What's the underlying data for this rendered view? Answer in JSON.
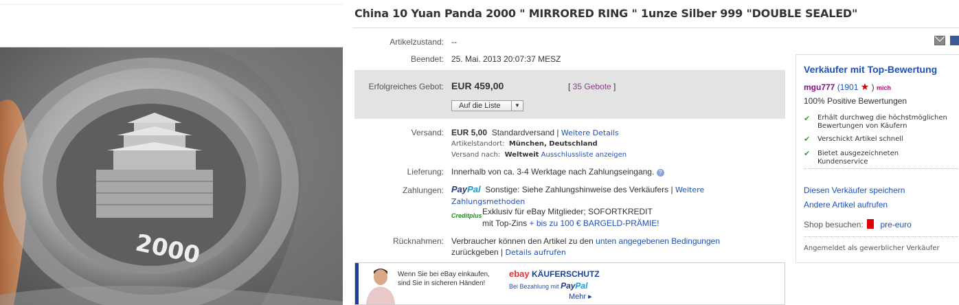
{
  "title": "China 10 Yuan Panda 2000 \" MIRRORED RING \" 1unze Silber 999 \"DOUBLE SEALED\"",
  "condition": {
    "label": "Artikelzustand:",
    "value": "--"
  },
  "ended": {
    "label": "Beendet:",
    "value": "25. Mai. 2013  20:07:37 MESZ"
  },
  "bid": {
    "label": "Erfolgreiches Gebot:",
    "price": "EUR 459,00",
    "bids_prefix": "[ ",
    "bids_link": "35 Gebote",
    "bids_suffix": " ]",
    "watch_button": "Auf die Liste"
  },
  "shipping": {
    "label": "Versand:",
    "price": "EUR 5,00",
    "method": "Standardversand |",
    "details_link": "Weitere Details",
    "location_label": "Artikelstandort:",
    "location": "München, Deutschland",
    "to_label": "Versand nach:",
    "to": "Weltweit",
    "exclusion_link": "Ausschlussliste anzeigen"
  },
  "delivery": {
    "label": "Lieferung:",
    "value": "Innerhalb von ca. 3-4 Werktage nach Zahlungseingang.",
    "help_icon": "?"
  },
  "payments": {
    "label": "Zahlungen:",
    "paypal_a": "Pay",
    "paypal_b": "Pal",
    "other": "Sonstige: Siehe Zahlungshinweise des Verkäufers  |",
    "more_link_a": "Weitere",
    "more_link_b": "Zahlungsmethoden",
    "credit_logo": "Creditplus",
    "credit_line1": "Exklusiv für eBay Mitglieder; SOFORTKREDIT",
    "credit_line2_a": "mit Top-Zins",
    "credit_line2_b": "+ bis zu 100 € BARGELD-PRÄMIE!"
  },
  "returns": {
    "label": "Rücknahmen:",
    "line1": "Verbraucher können den Artikel zu den",
    "line1_link": "unten angegebenen Bedingungen",
    "line2": "zurückgeben |",
    "details_link": "Details aufrufen"
  },
  "buyer_protection": {
    "text1": "Wenn Sie bei eBay einkaufen,",
    "text2": "sind Sie in sicheren Händen!",
    "ebay": "ebay",
    "title": "KÄUFERSCHUTZ",
    "sub": "Bei Bezahlung mit",
    "paypal_a": "Pay",
    "paypal_b": "Pal",
    "more": "Mehr ▸"
  },
  "seller": {
    "heading": "Verkäufer mit Top-Bewertung",
    "name": "mgu777",
    "score": "(1901",
    "score_end": ")",
    "me_badge": "mich",
    "positive": "100% Positive Bewertungen",
    "features": [
      {
        "line1": "Erhält durchweg die höchstmöglichen",
        "line2": "Bewertungen von Käufern"
      },
      {
        "line1": "Verschickt Artikel schnell",
        "line2": ""
      },
      {
        "line1": "Bietet ausgezeichneten",
        "line2": "Kundenservice"
      }
    ],
    "save_link": "Diesen Verkäufer speichern",
    "other_link": "Andere Artikel aufrufen",
    "shop_label": "Shop besuchen:",
    "shop_link": "pre-euro",
    "registered": "Angemeldet als gewerblicher Verkäufer"
  },
  "coin": {
    "year": "2000"
  },
  "colors": {
    "link": "#1c4fbd",
    "bid_bg": "#e3e3e3",
    "seller_name": "#8a0a8a",
    "star": "#e00000"
  }
}
